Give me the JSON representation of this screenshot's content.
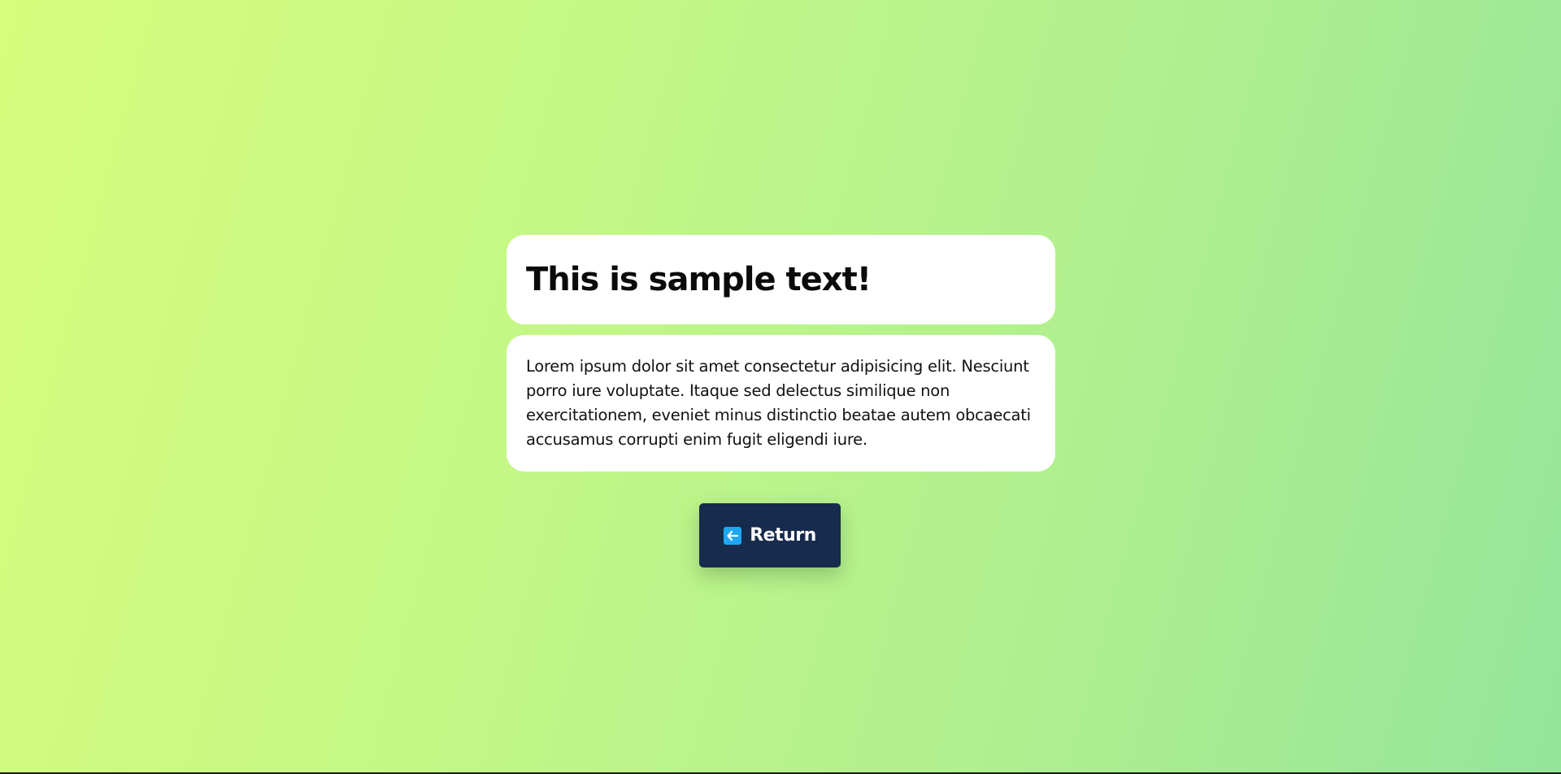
{
  "colors": {
    "background_start": "#d6fd7c",
    "background_end": "#95e59a",
    "card": "#ffffff",
    "button": "#172b4d",
    "icon_accent": "#1ea7f2"
  },
  "title_card": {
    "heading": "This is sample text!"
  },
  "body_card": {
    "paragraph": "Lorem ipsum dolor sit amet consectetur adipisicing elit. Nesciunt porro iure voluptate. Itaque sed delectus similique non exercitationem, eveniet minus distinctio beatae autem obcaecati accusamus corrupti enim fugit eligendi iure."
  },
  "return_button": {
    "label": "Return",
    "icon": "left-arrow-icon"
  }
}
